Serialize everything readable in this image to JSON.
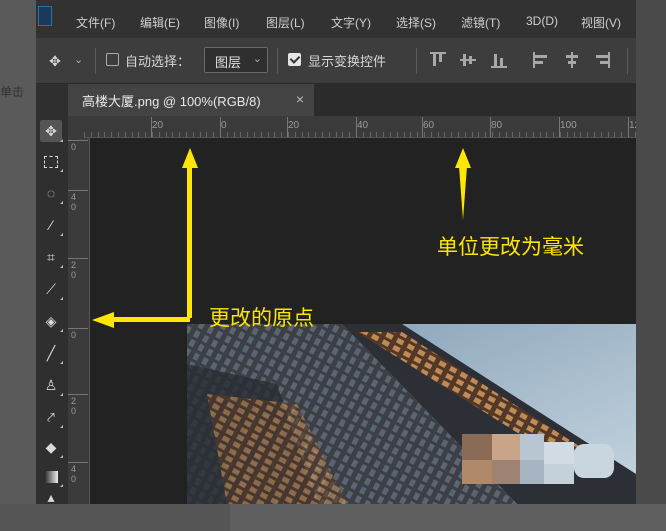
{
  "page": {
    "left_text": "单击"
  },
  "menubar": {
    "items": [
      "文件(F)",
      "编辑(E)",
      "图像(I)",
      "图层(L)",
      "文字(Y)",
      "选择(S)",
      "滤镜(T)",
      "3D(D)",
      "视图(V)"
    ]
  },
  "options": {
    "auto_select_label": "自动选择：",
    "auto_select_value": "图层",
    "show_transform_label": "显示变换控件",
    "show_transform_checked": true,
    "auto_select_checked": false
  },
  "document_tab": {
    "title": "高楼大厦.png @ 100%(RGB/8)",
    "close": "×"
  },
  "ruler": {
    "h_labels": [
      "20",
      "0",
      "20",
      "40",
      "60",
      "80",
      "100",
      "120"
    ],
    "v_labels": [
      "0",
      "4 0",
      "2 0",
      "0",
      "2 0",
      "4 0"
    ]
  },
  "annotations": {
    "unit_note": "单位更改为毫米",
    "origin_note": "更改的原点"
  },
  "colors": {
    "annotation": "#ffe600",
    "canvas": "#222222"
  }
}
